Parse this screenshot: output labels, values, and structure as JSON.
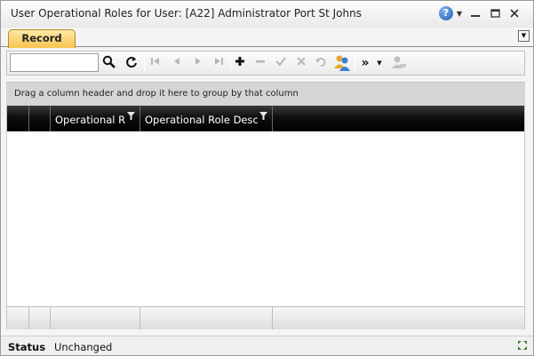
{
  "window": {
    "title": "User Operational Roles for User: [A22] Administrator Port St Johns"
  },
  "window_controls": {
    "help_glyph": "?",
    "help_icon": "help-icon",
    "dropdown_icon": "chevron-down-icon",
    "minimize_icon": "minimize-icon",
    "restore_icon": "restore-icon",
    "close_icon": "close-icon"
  },
  "tabs": [
    {
      "label": "Record",
      "active": true
    }
  ],
  "tab_menu_icon": "chevron-down-icon",
  "toolbar": {
    "search": {
      "value": "",
      "placeholder": ""
    },
    "icons": [
      "search-icon",
      "refresh-icon",
      "first-record-icon",
      "previous-record-icon",
      "next-record-icon",
      "last-record-icon",
      "add-icon",
      "remove-icon",
      "confirm-icon",
      "cancel-icon",
      "undo-icon",
      "assign-users-icon",
      "more-icon",
      "more-dropdown-icon",
      "user-action-icon"
    ]
  },
  "group_panel": {
    "text": "Drag a column header and drop it here to group by that column"
  },
  "grid": {
    "columns": [
      {
        "label": ""
      },
      {
        "label": ""
      },
      {
        "label": "Operational R"
      },
      {
        "label": "Operational Role Desc"
      }
    ],
    "rows": []
  },
  "status": {
    "label": "Status",
    "value": "Unchanged"
  },
  "colors": {
    "tab_active": "#f8c34e",
    "grid_header": "#000000",
    "help_blue": "#1d5db8"
  }
}
